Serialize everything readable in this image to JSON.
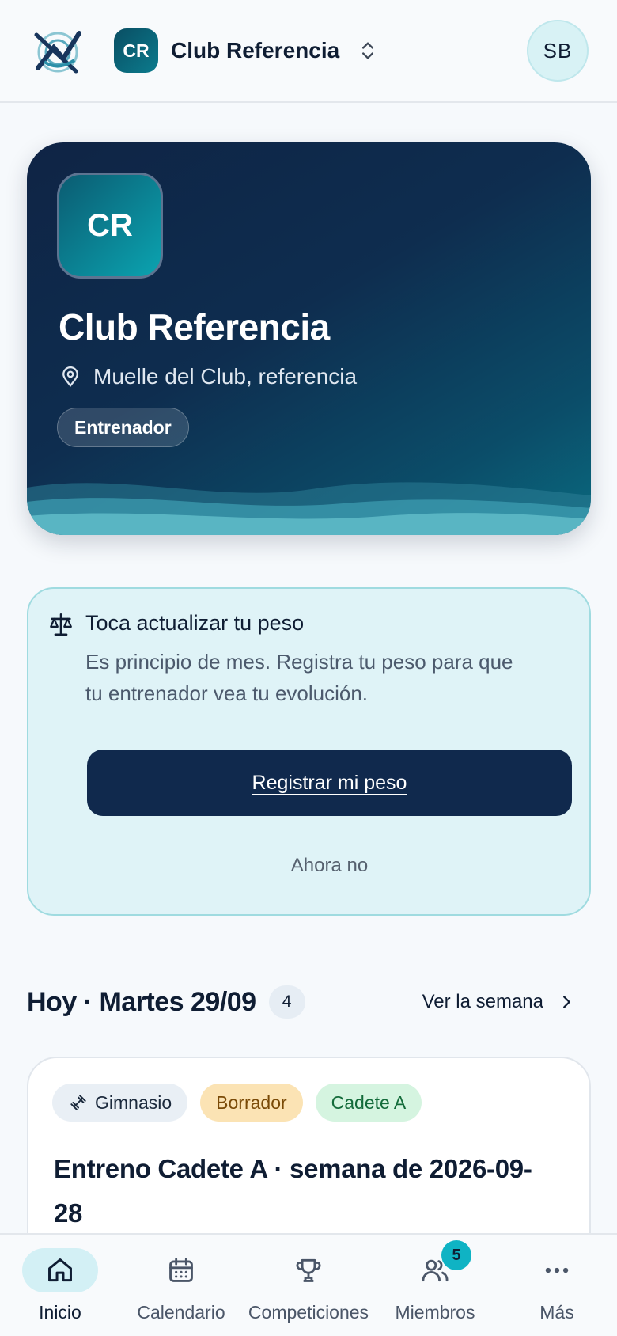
{
  "header": {
    "club_initials": "CR",
    "club_name": "Club Referencia",
    "user_initials": "SB"
  },
  "hero": {
    "initials": "CR",
    "title": "Club Referencia",
    "location": "Muelle del Club, referencia",
    "role": "Entrenador"
  },
  "weight_prompt": {
    "title": "Toca actualizar tu peso",
    "text": "Es principio de mes. Registra tu peso para que tu entrenador vea tu evolución.",
    "primary_label": "Registrar mi peso",
    "secondary_label": "Ahora no"
  },
  "today": {
    "title": "Hoy · Martes 29/09",
    "count": "4",
    "week_link": "Ver la semana"
  },
  "session": {
    "tags": [
      "Gimnasio",
      "Borrador",
      "Cadete A"
    ],
    "title": "Entreno Cadete A · semana de 2026-09-28"
  },
  "nav": {
    "items": [
      {
        "label": "Inicio",
        "icon": "home-icon"
      },
      {
        "label": "Calendario",
        "icon": "calendar-icon"
      },
      {
        "label": "Competiciones",
        "icon": "trophy-icon"
      },
      {
        "label": "Miembros",
        "icon": "users-icon",
        "badge": "5"
      },
      {
        "label": "Más",
        "icon": "more-icon"
      }
    ]
  },
  "colors": {
    "primary": "#10294d",
    "accent": "#0fb3c4",
    "hero_start": "#0f2445",
    "hero_end": "#0a6a7f"
  }
}
